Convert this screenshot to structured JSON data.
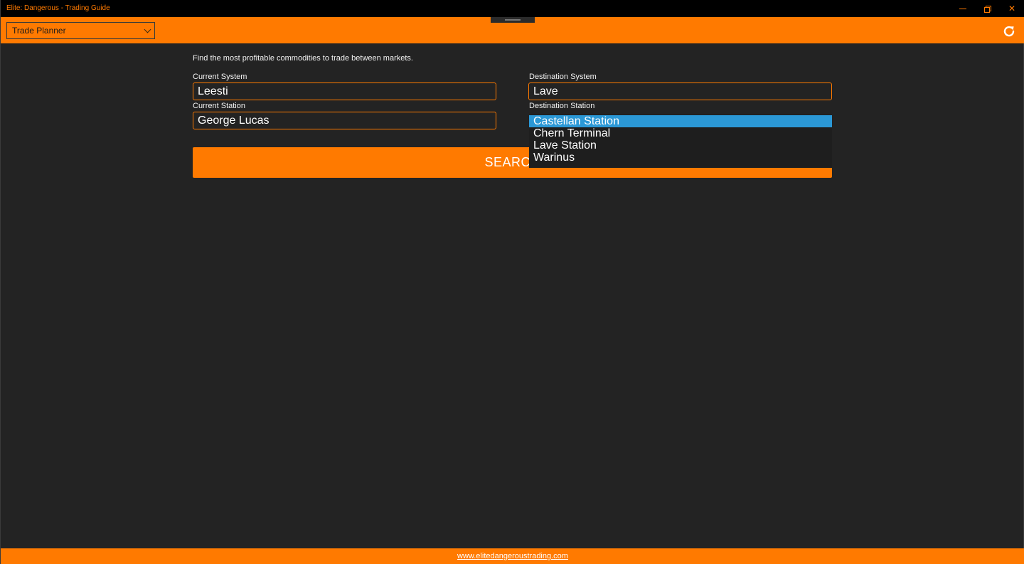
{
  "window": {
    "title": "Elite: Dangerous - Trading Guide",
    "controls": {
      "minimize": "minimize",
      "maximize": "restore",
      "close": "✕"
    }
  },
  "toolbar": {
    "page_select_value": "Trade Planner",
    "refresh_icon": "refresh-icon"
  },
  "main": {
    "intro": "Find the most profitable commodities to trade between markets.",
    "current_system": {
      "label": "Current System",
      "value": "Leesti"
    },
    "current_station": {
      "label": "Current Station",
      "value": "George Lucas"
    },
    "destination_system": {
      "label": "Destination System",
      "value": "Lave"
    },
    "destination_station": {
      "label": "Destination Station",
      "options": [
        "Castellan Station",
        "Chern Terminal",
        "Lave Station",
        "Warinus"
      ],
      "selected": "Castellan Station"
    },
    "search_label": "SEARCH"
  },
  "footer": {
    "link": "www.elitedangeroustrading.com"
  },
  "colors": {
    "accent": "#ff7a00",
    "background": "#232323",
    "selection": "#2b98d6"
  }
}
